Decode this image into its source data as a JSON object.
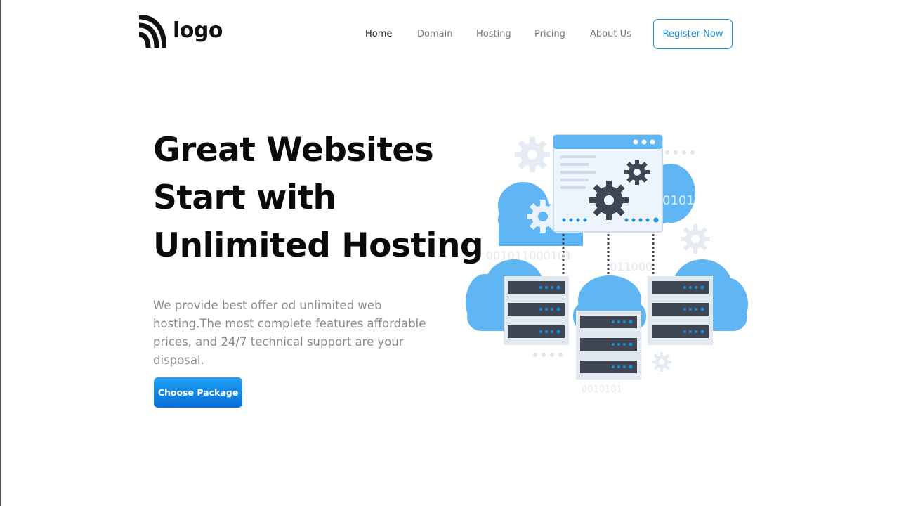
{
  "brand": {
    "logo_text": "logo"
  },
  "nav": {
    "items": [
      {
        "label": "Home",
        "active": true
      },
      {
        "label": "Domain",
        "active": false
      },
      {
        "label": "Hosting",
        "active": false
      },
      {
        "label": "Pricing",
        "active": false
      },
      {
        "label": "About Us",
        "active": false
      }
    ],
    "register_label": "Register Now"
  },
  "hero": {
    "title_lines": [
      "Great Websites",
      "Start with",
      "Unlimited Hosting"
    ],
    "description": "We provide best offer od unlimited web hosting.The most complete features affordable prices, and 24/7 technical support are your disposal.",
    "cta_label": "Choose Package"
  },
  "illustration": {
    "binary_1": "0101",
    "binary_2": "001011000101",
    "binary_3": "011000",
    "binary_4": "0010101"
  },
  "colors": {
    "accent": "#1a8fe0",
    "cloud": "#58b2f0",
    "cloud_dark": "#3d9ee6",
    "server": "#3f4552",
    "text_dark": "#0a0a0a",
    "text_muted": "#8a8a8a"
  },
  "icons": [
    "logo-mark-icon",
    "gear-icon",
    "cloud-icon",
    "server-icon",
    "browser-window-icon"
  ]
}
